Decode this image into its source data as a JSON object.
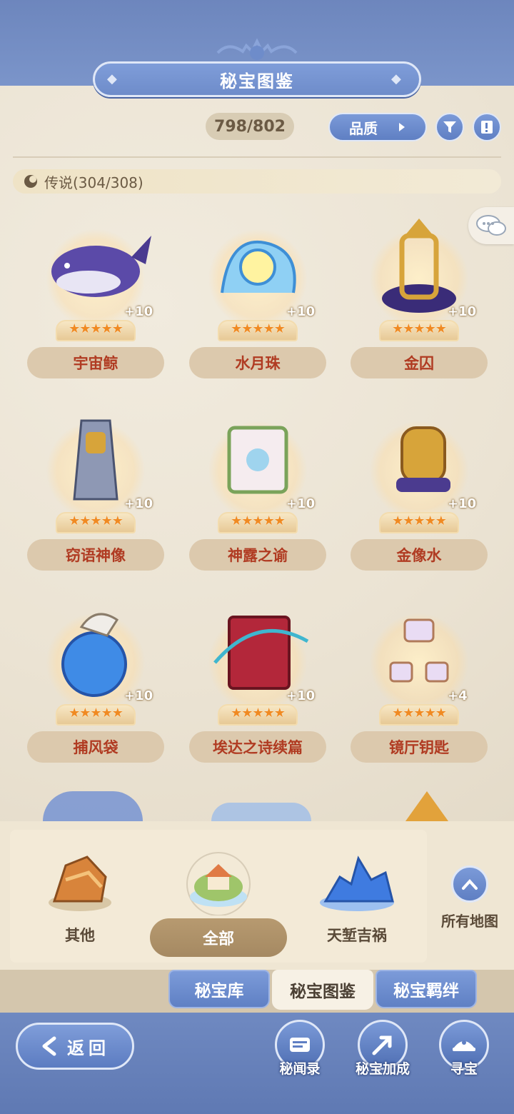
{
  "header": {
    "title": "秘宝图鉴"
  },
  "collection": {
    "progress": "798/802"
  },
  "controls": {
    "sort_label": "品质"
  },
  "section": {
    "label": "传说(304/308)"
  },
  "items": [
    {
      "name": "宇宙鲸",
      "level": "+10",
      "stars": "★★★★★",
      "art": "cosmic-whale"
    },
    {
      "name": "水月珠",
      "level": "+10",
      "stars": "★★★★★",
      "art": "water-moon-pearl"
    },
    {
      "name": "金囚",
      "level": "+10",
      "stars": "★★★★★",
      "art": "golden-cage"
    },
    {
      "name": "窃语神像",
      "level": "+10",
      "stars": "★★★★★",
      "art": "whispering-statue"
    },
    {
      "name": "神露之谕",
      "level": "+10",
      "stars": "★★★★★",
      "art": "divine-scroll"
    },
    {
      "name": "金像水",
      "level": "+10",
      "stars": "★★★★★",
      "art": "golden-bottle"
    },
    {
      "name": "捕风袋",
      "level": "+10",
      "stars": "★★★★★",
      "art": "wind-bag"
    },
    {
      "name": "埃达之诗续篇",
      "level": "+10",
      "stars": "★★★★★",
      "art": "poem-book"
    },
    {
      "name": "镜厅钥匙",
      "level": "+4",
      "stars": "★★★★★",
      "art": "mirror-key"
    }
  ],
  "map_filter": {
    "options": [
      {
        "label": "其他"
      },
      {
        "label": "全部"
      },
      {
        "label": "天堑吉祸"
      }
    ],
    "all_maps_label": "所有地图"
  },
  "tabs": [
    {
      "label": "秘宝库"
    },
    {
      "label": "秘宝图鉴"
    },
    {
      "label": "秘宝羁绊"
    }
  ],
  "bottom": {
    "back_label": "返回",
    "features": [
      {
        "label": "秘闻录"
      },
      {
        "label": "秘宝加成"
      },
      {
        "label": "寻宝"
      }
    ]
  },
  "colors": {
    "accent_blue": "#6e8cca",
    "name_red": "#b03b22",
    "star_orange": "#f08a22"
  }
}
